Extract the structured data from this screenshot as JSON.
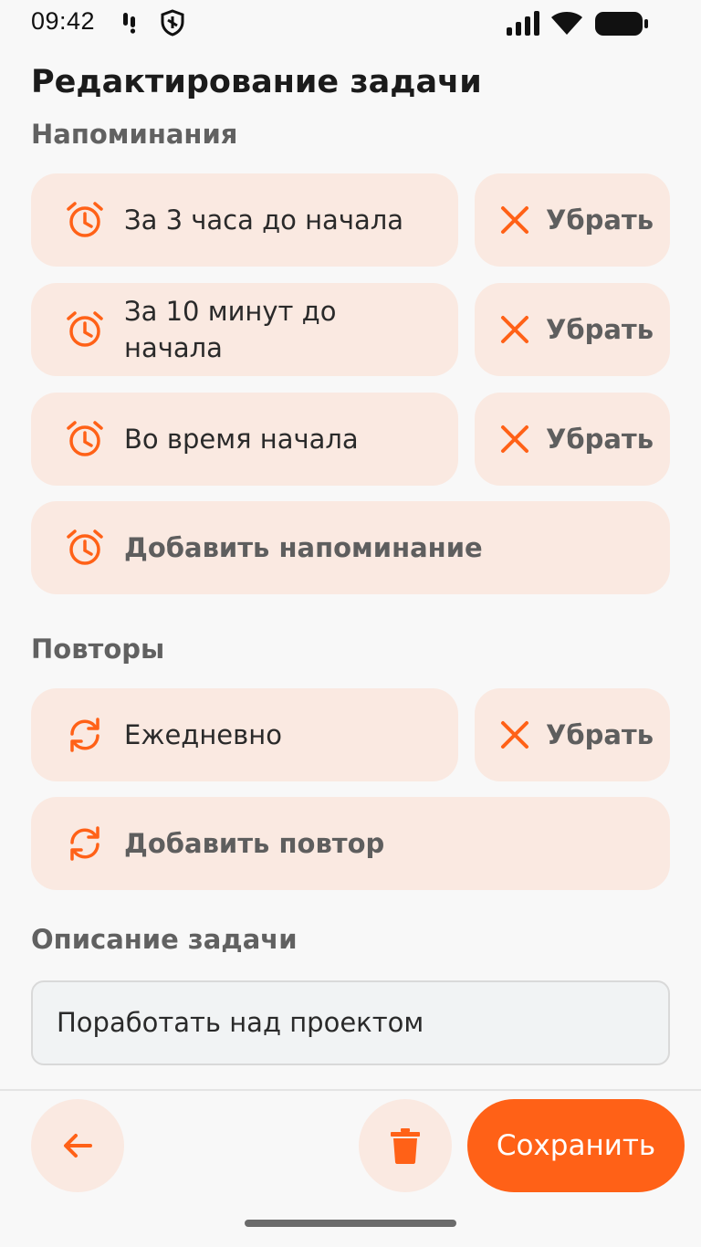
{
  "status": {
    "time": "09:42"
  },
  "page_title": "Редактирование задачи",
  "reminders": {
    "label": "Напоминания",
    "items": [
      {
        "text": "За 3 часа до начала",
        "icon": "alarm-icon",
        "remove_label": "Убрать"
      },
      {
        "text": "За 10 минут до начала",
        "icon": "alarm-icon",
        "remove_label": "Убрать"
      },
      {
        "text": "Во время начала",
        "icon": "alarm-icon",
        "remove_label": "Убрать"
      }
    ],
    "add_label": "Добавить напоминание"
  },
  "repeats": {
    "label": "Повторы",
    "items": [
      {
        "text": "Ежедневно",
        "icon": "repeat-icon",
        "remove_label": "Убрать"
      }
    ],
    "add_label": "Добавить повтор"
  },
  "description": {
    "label": "Описание задачи",
    "value": "Поработать над проектом"
  },
  "bottom_bar": {
    "save_label": "Сохранить"
  },
  "colors": {
    "accent": "#ff6117",
    "chip_bg": "#fae9e1",
    "background": "#f8f8f8"
  }
}
